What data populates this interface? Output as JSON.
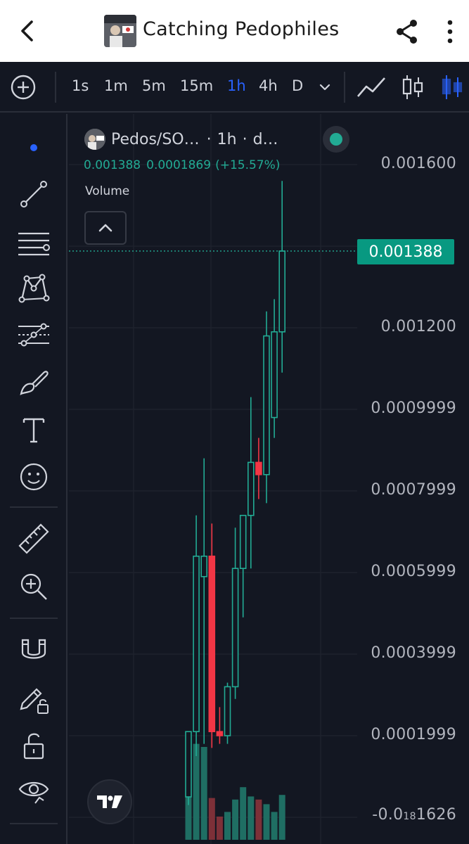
{
  "appbar": {
    "title": "Catching Pedophiles",
    "icons": {
      "back": "back-arrow-icon",
      "share": "share-icon",
      "more": "more-vert-icon"
    }
  },
  "toolbar": {
    "timeframes": [
      "1s",
      "1m",
      "5m",
      "15m",
      "1h",
      "4h",
      "D"
    ],
    "active_timeframe": "1h",
    "icons": {
      "add": "add-circle-icon",
      "dropdown": "chevron-down-icon",
      "line": "line-chart-icon",
      "candles": "candlestick-icon",
      "bars": "bar-chart-icon"
    }
  },
  "left_tools": {
    "icons": [
      "crosshair-dot-icon",
      "trend-line-icon",
      "parallel-lines-icon",
      "pattern-icon",
      "fib-icon",
      "brush-icon",
      "text-icon",
      "emoji-icon",
      "ruler-icon",
      "zoom-in-icon",
      "magnet-icon",
      "lock-pencil-icon",
      "unlock-icon",
      "eye-icon"
    ]
  },
  "legend": {
    "symbol": "Pedos/SO…",
    "sep1": "·",
    "interval": "1h",
    "sep2": "·",
    "source": "d…",
    "ohlc_close": "0.001388",
    "ohlc_change": "0.0001869",
    "ohlc_pct": "(+15.57%)",
    "volume_label": "Volume"
  },
  "price_axis": {
    "labels": [
      "0.001600",
      "0.001200",
      "0.0009999",
      "0.0007999",
      "0.0005999",
      "0.0003999",
      "0.0001999"
    ],
    "bottom_label_main": "-0.0",
    "bottom_label_sub": "18",
    "bottom_label_tail": "1626",
    "last_price": "0.001388"
  },
  "colors": {
    "up": "#22ab94",
    "down": "#f23645",
    "background": "#131722",
    "accent": "#2962ff"
  },
  "chart_data": {
    "type": "candlestick",
    "interval": "1h",
    "ylim": [
      -0.0001626,
      0.0016
    ],
    "candles": [
      {
        "open": 5e-05,
        "high": 0.00021,
        "low": 3e-05,
        "close": 0.00021,
        "volume": 0.55
      },
      {
        "open": 0.00021,
        "high": 0.00074,
        "low": 0.00015,
        "close": 0.00064,
        "volume": 0.62
      },
      {
        "open": 0.00059,
        "high": 0.00088,
        "low": 0.00018,
        "close": 0.00064,
        "volume": 0.6
      },
      {
        "open": 0.00064,
        "high": 0.00072,
        "low": 0.00017,
        "close": 0.00021,
        "volume": 0.27
      },
      {
        "open": 0.00021,
        "high": 0.00027,
        "low": 0.00018,
        "close": 0.0002,
        "volume": 0.15
      },
      {
        "open": 0.0002,
        "high": 0.00033,
        "low": 0.00018,
        "close": 0.00032,
        "volume": 0.18
      },
      {
        "open": 0.00032,
        "high": 0.00071,
        "low": 0.00029,
        "close": 0.00061,
        "volume": 0.26
      },
      {
        "open": 0.00061,
        "high": 0.00073,
        "low": 0.00049,
        "close": 0.00074,
        "volume": 0.34
      },
      {
        "open": 0.00074,
        "high": 0.00103,
        "low": 0.00061,
        "close": 0.00087,
        "volume": 0.28
      },
      {
        "open": 0.00087,
        "high": 0.00093,
        "low": 0.00078,
        "close": 0.00084,
        "volume": 0.26
      },
      {
        "open": 0.00084,
        "high": 0.00124,
        "low": 0.00077,
        "close": 0.00118,
        "volume": 0.23
      },
      {
        "open": 0.00098,
        "high": 0.00127,
        "low": 0.00093,
        "close": 0.00119,
        "volume": 0.18
      },
      {
        "open": 0.00119,
        "high": 0.00156,
        "low": 0.00109,
        "close": 0.001388,
        "volume": 0.29
      }
    ]
  }
}
